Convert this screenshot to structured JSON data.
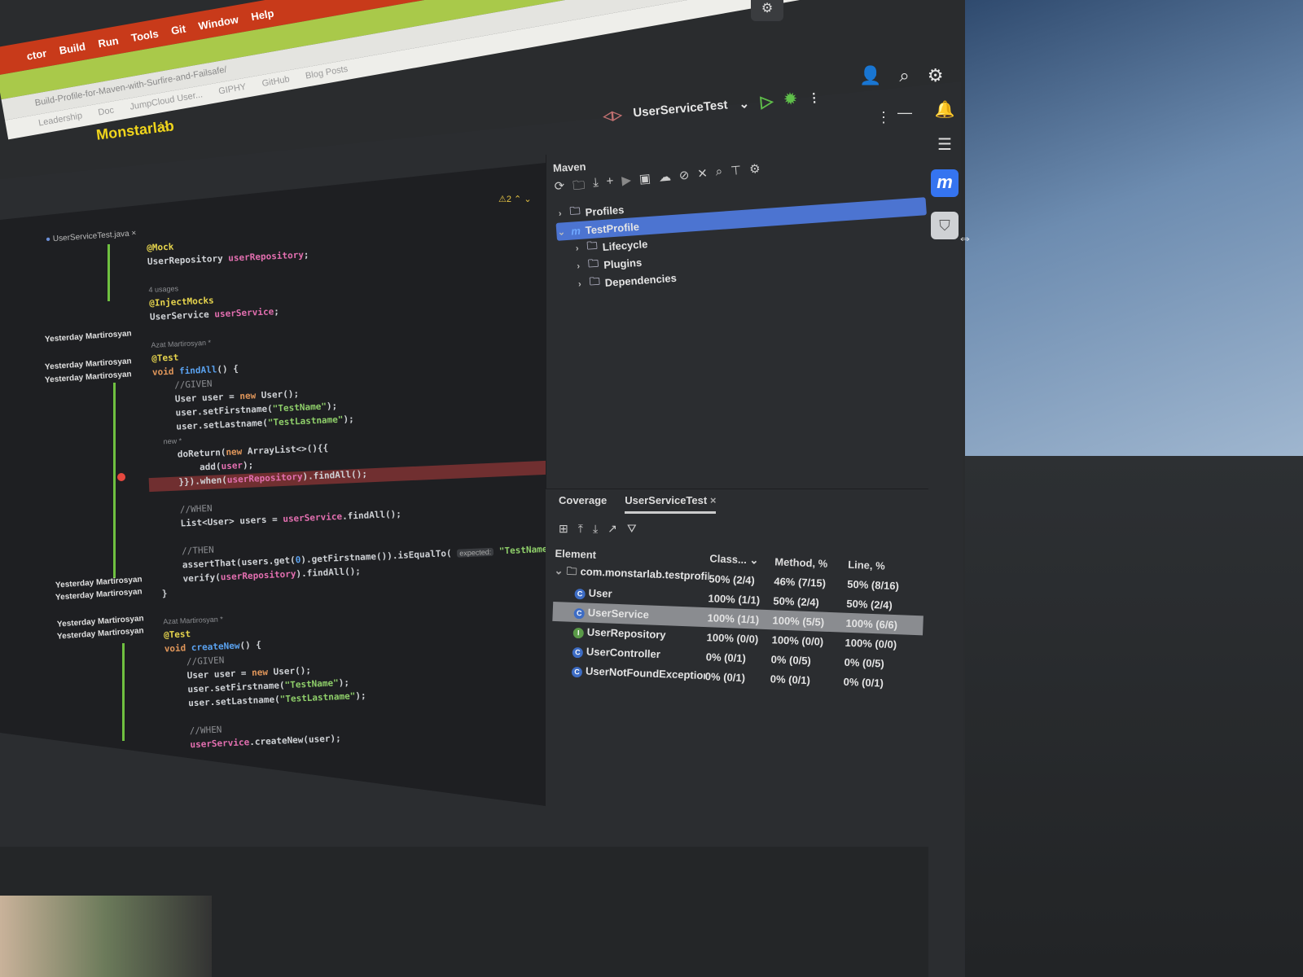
{
  "browser": {
    "menu": [
      "ctor",
      "Build",
      "Run",
      "Tools",
      "Git",
      "Window",
      "Help"
    ],
    "url": "Build-Profile-for-Maven-with-Surfire-and-Failsafe/",
    "bookmarks": [
      "Leadership",
      "Doc",
      "JumpCloud User...",
      "GIPHY",
      "GitHub",
      "Blog Posts"
    ],
    "brand": "Monstarlab"
  },
  "title": {
    "run_config": "UserServiceTest",
    "icons": [
      "run-icon",
      "debug-icon",
      "more-icon"
    ]
  },
  "editor": {
    "tab": "UserServiceTest.java",
    "warnings": "2",
    "blame": "Yesterday Martirosyan",
    "code": [
      [
        [
          "a",
          "@Mock"
        ]
      ],
      [
        [
          "",
          "UserRepository "
        ],
        [
          "f",
          "userRepository"
        ],
        [
          "",
          ";"
        ]
      ],
      [],
      [
        [
          "h",
          "4 usages"
        ]
      ],
      [
        [
          "a",
          "@InjectMocks"
        ]
      ],
      [
        [
          "",
          "UserService "
        ],
        [
          "f",
          "userService"
        ],
        [
          "",
          ";"
        ]
      ],
      [],
      [
        [
          "h",
          "Azat Martirosyan *"
        ]
      ],
      [
        [
          "a",
          "@Test"
        ]
      ],
      [
        [
          "k",
          "void "
        ],
        [
          "m",
          "findAll"
        ],
        [
          "",
          "() {"
        ]
      ],
      [
        [
          "c",
          "    //GIVEN"
        ]
      ],
      [
        [
          "",
          "    User user = "
        ],
        [
          "k",
          "new "
        ],
        [
          "",
          "User();"
        ]
      ],
      [
        [
          "",
          "    user.setFirstname("
        ],
        [
          "s",
          "\"TestName\""
        ],
        [
          "",
          ");"
        ]
      ],
      [
        [
          "",
          "    user.setLastname("
        ],
        [
          "s",
          "\"TestLastname\""
        ],
        [
          "",
          ");"
        ]
      ],
      [
        [
          "h",
          "    new *"
        ]
      ],
      [
        [
          "",
          "    doReturn("
        ],
        [
          "k",
          "new "
        ],
        [
          "",
          "ArrayList<>(){{"
        ]
      ],
      [
        [
          "",
          "        add("
        ],
        [
          "f",
          "user"
        ],
        [
          "",
          ");"
        ]
      ],
      [
        [
          "",
          "    }}).when("
        ],
        [
          "f",
          "userRepository"
        ],
        [
          "",
          ").findAll();"
        ]
      ],
      [],
      [
        [
          "c",
          "    //WHEN"
        ]
      ],
      [
        [
          "",
          "    List<User> users = "
        ],
        [
          "f",
          "userService"
        ],
        [
          "",
          ".findAll();"
        ]
      ],
      [],
      [
        [
          "c",
          "    //THEN"
        ]
      ],
      [
        [
          "",
          "    assertThat(users.get("
        ],
        [
          "m",
          "0"
        ],
        [
          "",
          ").getFirstname()).isEqualTo( "
        ],
        [
          "hint",
          "expected:"
        ],
        [
          "s",
          " \"TestName\""
        ],
        [
          "",
          ");"
        ]
      ],
      [
        [
          "",
          "    verify("
        ],
        [
          "f",
          "userRepository"
        ],
        [
          "",
          ").findAll();"
        ]
      ],
      [
        [
          "",
          "}"
        ]
      ],
      [],
      [
        [
          "h",
          "Azat Martirosyan *"
        ]
      ],
      [
        [
          "a",
          "@Test"
        ]
      ],
      [
        [
          "k",
          "void "
        ],
        [
          "m",
          "createNew"
        ],
        [
          "",
          "() {"
        ]
      ],
      [
        [
          "c",
          "    //GIVEN"
        ]
      ],
      [
        [
          "",
          "    User user = "
        ],
        [
          "k",
          "new "
        ],
        [
          "",
          "User();"
        ]
      ],
      [
        [
          "",
          "    user.setFirstname("
        ],
        [
          "s",
          "\"TestName\""
        ],
        [
          "",
          ");"
        ]
      ],
      [
        [
          "",
          "    user.setLastname("
        ],
        [
          "s",
          "\"TestLastname\""
        ],
        [
          "",
          ");"
        ]
      ],
      [],
      [
        [
          "c",
          "    //WHEN"
        ]
      ],
      [
        [
          "f",
          "    userService"
        ],
        [
          "",
          ".createNew(user);"
        ]
      ]
    ]
  },
  "maven": {
    "title": "Maven",
    "tree": [
      {
        "label": "Profiles",
        "level": 0,
        "expanded": false,
        "selected": false,
        "icon": "folder"
      },
      {
        "label": "TestProfile",
        "level": 0,
        "expanded": true,
        "selected": true,
        "icon": "maven"
      },
      {
        "label": "Lifecycle",
        "level": 1,
        "expanded": false,
        "selected": false,
        "icon": "folder"
      },
      {
        "label": "Plugins",
        "level": 1,
        "expanded": false,
        "selected": false,
        "icon": "folder"
      },
      {
        "label": "Dependencies",
        "level": 1,
        "expanded": false,
        "selected": false,
        "icon": "folder"
      }
    ]
  },
  "coverage": {
    "tabs": [
      "Coverage",
      "UserServiceTest"
    ],
    "columns": [
      "Element",
      "Class...",
      "Method, %",
      "Line, %"
    ],
    "rows": [
      {
        "name": "com.monstarlab.testprofile.us",
        "type": "package",
        "class": "50% (2/4)",
        "method": "46% (7/15)",
        "line": "50% (8/16)"
      },
      {
        "name": "User",
        "type": "class",
        "class": "100% (1/1)",
        "method": "50% (2/4)",
        "line": "50% (2/4)"
      },
      {
        "name": "UserService",
        "type": "class",
        "class": "100% (1/1)",
        "method": "100% (5/5)",
        "line": "100% (6/6)",
        "selected": true
      },
      {
        "name": "UserRepository",
        "type": "interface",
        "class": "100% (0/0)",
        "method": "100% (0/0)",
        "line": "100% (0/0)"
      },
      {
        "name": "UserController",
        "type": "class",
        "class": "0% (0/1)",
        "method": "0% (0/5)",
        "line": "0% (0/5)"
      },
      {
        "name": "UserNotFoundException",
        "type": "class",
        "class": "0% (0/1)",
        "method": "0% (0/1)",
        "line": "0% (0/1)"
      }
    ]
  },
  "colors": {
    "accent": "#3574f0",
    "selection": "#4c74d1",
    "breakpoint": "#e5483f",
    "change": "#6fc040"
  }
}
